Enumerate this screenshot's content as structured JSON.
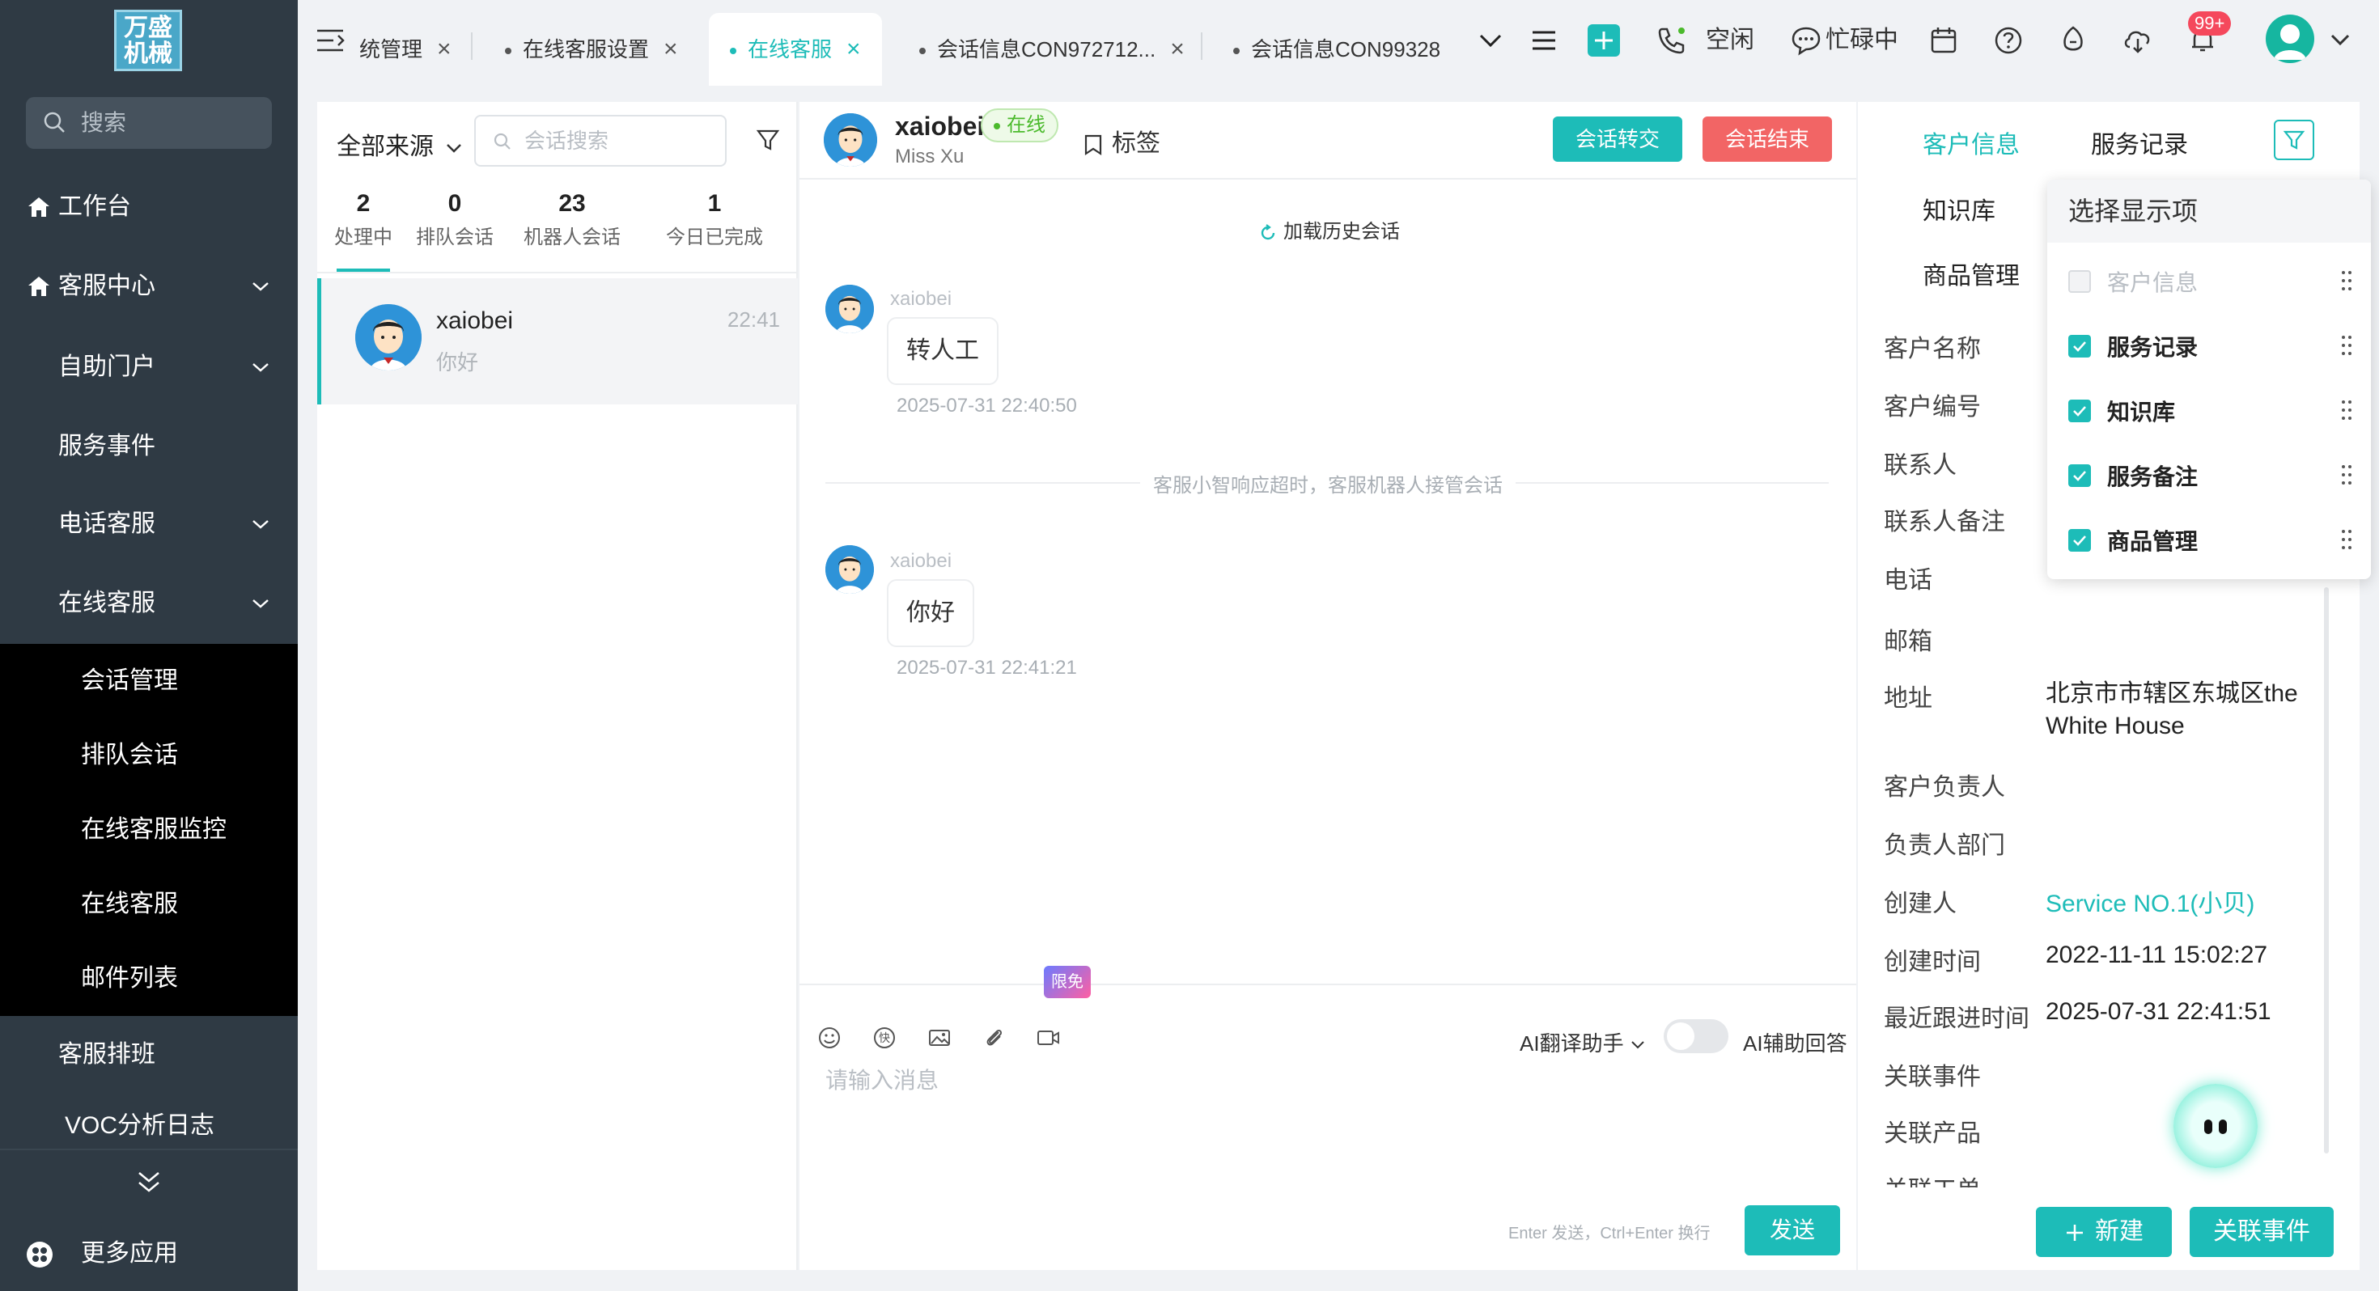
{
  "colors": {
    "accent": "#1dbcb8",
    "sidebar_bg": "#2f3a44",
    "danger": "#f26565",
    "online": "#4bba2c"
  },
  "sidebar": {
    "logo_text": "万盛机械",
    "search_placeholder": "搜索",
    "items": [
      {
        "label": "工作台",
        "icon": "home-icon"
      },
      {
        "label": "客服中心",
        "icon": "home-icon"
      },
      {
        "label": "自助门户"
      },
      {
        "label": "服务事件"
      },
      {
        "label": "电话客服"
      },
      {
        "label": "在线客服"
      }
    ],
    "children": [
      "会话管理",
      "排队会话",
      "在线客服监控",
      "在线客服",
      "邮件列表"
    ],
    "after": [
      "客服排班",
      "VOC分析日志"
    ],
    "more_apps": "更多应用"
  },
  "topbar": {
    "tabs": [
      {
        "label": "统管理"
      },
      {
        "label": "在线客服设置"
      },
      {
        "label": "在线客服"
      },
      {
        "label": "会话信息CON972712..."
      },
      {
        "label": "会话信息CON99328"
      }
    ],
    "status_idle": "空闲",
    "status_busy": "忙碌中",
    "notification_badge": "99+"
  },
  "list": {
    "source_filter": "全部来源",
    "search_placeholder": "会话搜索",
    "stats": [
      {
        "num": "2",
        "label": "处理中"
      },
      {
        "num": "0",
        "label": "排队会话"
      },
      {
        "num": "23",
        "label": "机器人会话"
      },
      {
        "num": "1",
        "label": "今日已完成"
      }
    ],
    "conversations": [
      {
        "name": "xaiobei",
        "last_msg": "你好",
        "time": "22:41"
      }
    ]
  },
  "chat": {
    "name": "xaiobei",
    "status": "在线",
    "subtitle": "Miss Xu",
    "tag_label": "标签",
    "transfer_label": "会话转交",
    "end_label": "会话结束",
    "load_history": "加载历史会话",
    "messages": [
      {
        "sender": "xaiobei",
        "text": "转人工",
        "time": "2025-07-31 22:40:50"
      },
      {
        "sender": "xaiobei",
        "text": "你好",
        "time": "2025-07-31 22:41:21"
      }
    ],
    "system_notice": "客服小智响应超时，客服机器人接管会话",
    "free_badge": "限免",
    "ai_translate": "AI翻译助手",
    "ai_assist": "AI辅助回答",
    "input_placeholder": "请输入消息",
    "send_hint": "Enter 发送，Ctrl+Enter 换行",
    "send_label": "发送"
  },
  "info": {
    "tabs": [
      "客户信息",
      "服务记录",
      "知识库",
      "商品管理"
    ],
    "fields": [
      {
        "label": "客户名称",
        "value": ""
      },
      {
        "label": "客户编号",
        "value": ""
      },
      {
        "label": "联系人",
        "value": ""
      },
      {
        "label": "联系人备注",
        "value": ""
      },
      {
        "label": "电话",
        "value": ""
      },
      {
        "label": "邮箱",
        "value": ""
      },
      {
        "label": "地址",
        "value": "北京市市辖区东城区the White House"
      },
      {
        "label": "客户负责人",
        "value": ""
      },
      {
        "label": "负责人部门",
        "value": ""
      },
      {
        "label": "创建人",
        "value": "Service NO.1(小贝)"
      },
      {
        "label": "创建时间",
        "value": "2022-11-11 15:02:27"
      },
      {
        "label": "最近跟进时间",
        "value": "2025-07-31 22:41:51"
      },
      {
        "label": "关联事件",
        "value": ""
      },
      {
        "label": "关联产品",
        "value": ""
      },
      {
        "label": "关联工单",
        "value": ""
      }
    ],
    "new_label": "新建",
    "link_event_label": "关联事件",
    "display_menu": {
      "title": "选择显示项",
      "items": [
        {
          "label": "客户信息",
          "checked": true,
          "disabled": true
        },
        {
          "label": "服务记录",
          "checked": true
        },
        {
          "label": "知识库",
          "checked": true
        },
        {
          "label": "服务备注",
          "checked": true
        },
        {
          "label": "商品管理",
          "checked": true
        }
      ]
    }
  }
}
